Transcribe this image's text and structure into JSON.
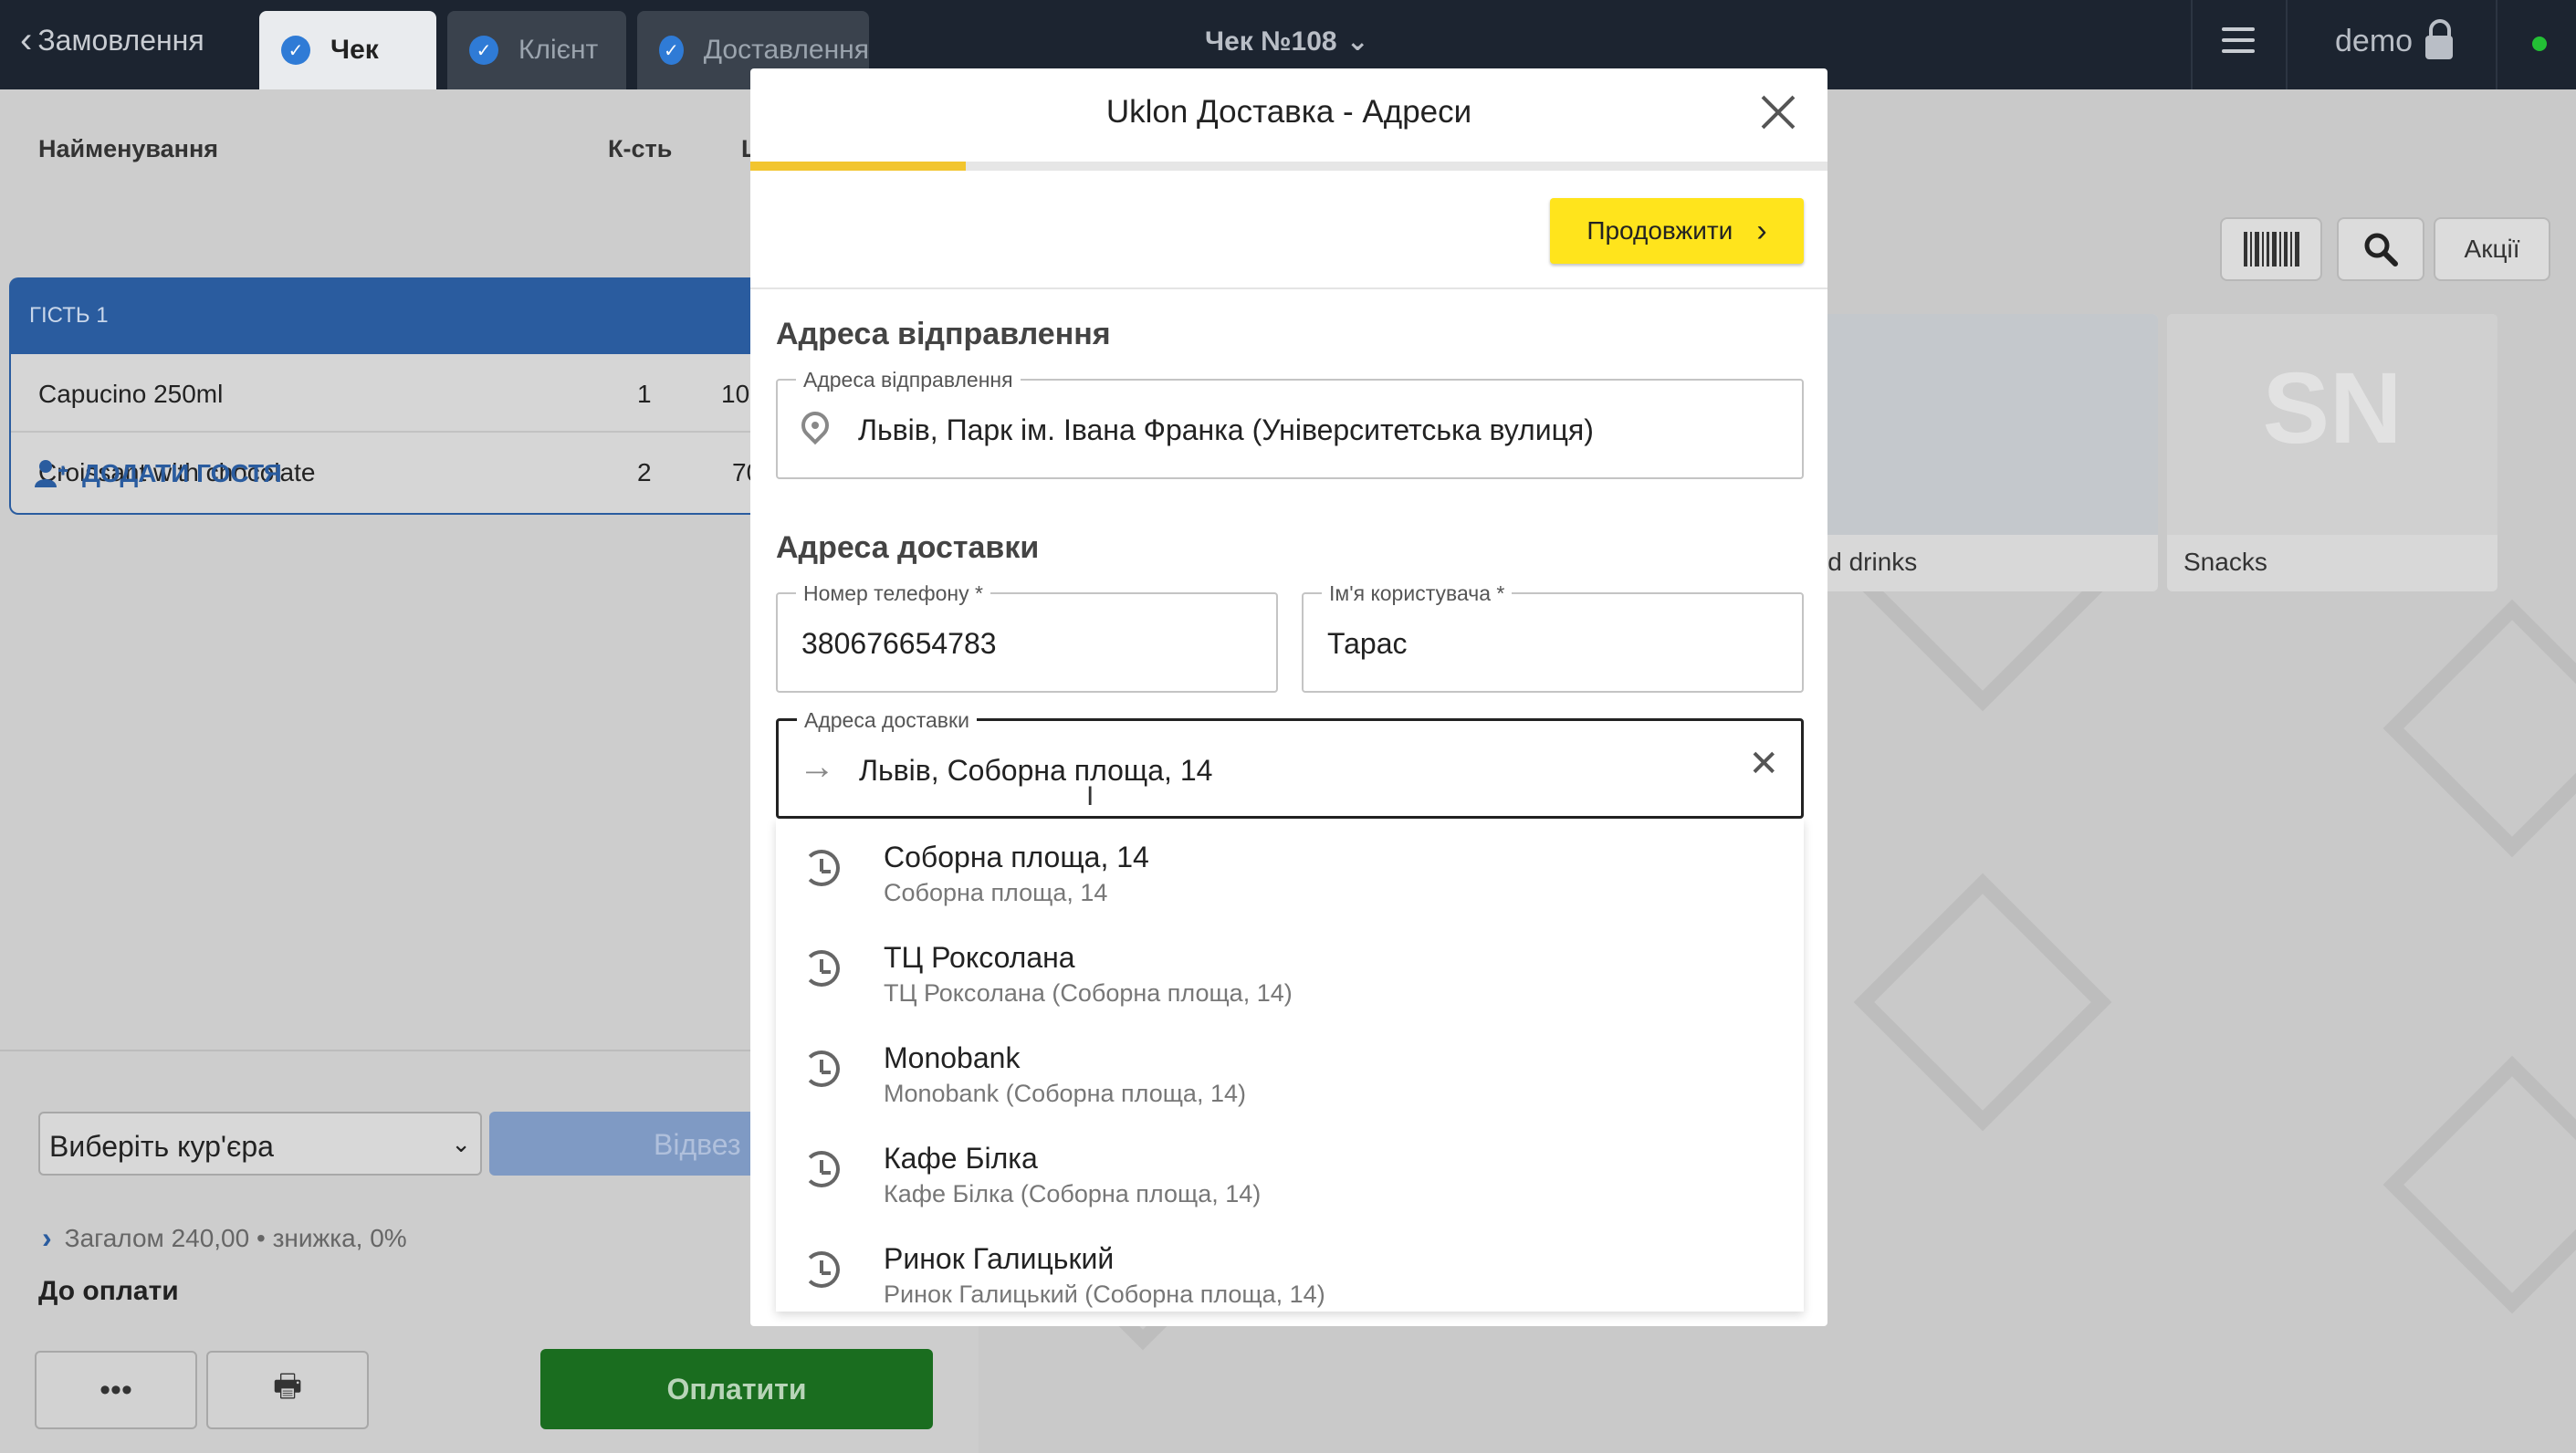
{
  "topbar": {
    "back_label": "Замовлення",
    "tabs": [
      {
        "label": "Чек",
        "active": true
      },
      {
        "label": "Клієнт",
        "active": false
      },
      {
        "label": "Доставлення",
        "active": false
      }
    ],
    "check_title": "Чек №108",
    "user": "demo",
    "status_color": "#23c035"
  },
  "order": {
    "headers": {
      "name": "Найменування",
      "qty": "К-сть",
      "price": "Ц"
    },
    "guest": "ГІСТЬ 1",
    "items": [
      {
        "name": "Capucino 250ml",
        "qty": "1",
        "price": "10"
      },
      {
        "name": "Croissant with chocolate",
        "qty": "2",
        "price": "70"
      }
    ],
    "add_guest": "ДОДАТИ ГОСТЯ"
  },
  "bottom": {
    "courier_placeholder": "Виберіть кур'єра",
    "send_label": "Відвез",
    "total_line": "Загалом 240,00 • знижка, 0%",
    "to_pay": "До оплати",
    "more_label": "•••",
    "print_label": "🖶",
    "pay_label": "Оплатити"
  },
  "right": {
    "promo_label": "Акції",
    "categories": [
      {
        "label": "ld drinks"
      },
      {
        "label": "Snacks",
        "initials": "SN"
      }
    ]
  },
  "modal": {
    "title": "Uklon Доставка - Адреси",
    "progress": 0.2,
    "continue_label": "Продовжити",
    "pickup_section": "Адреса відправлення",
    "pickup_field_label": "Адреса відправлення",
    "pickup_value": "Львів, Парк ім. Івана Франка (Університетська вулиця)",
    "delivery_section": "Адреса доставки",
    "phone_label": "Номер телефону *",
    "phone_value": "380676654783",
    "username_label": "Ім'я користувача *",
    "username_value": "Тарас",
    "delivery_field_label": "Адреса доставки",
    "delivery_value": "Львів, Соборна площа, 14",
    "suggestions": [
      {
        "title": "Соборна площа, 14",
        "subtitle": "Соборна площа, 14"
      },
      {
        "title": "ТЦ Роксолана",
        "subtitle": "ТЦ Роксолана (Соборна площа, 14)"
      },
      {
        "title": "Monobank",
        "subtitle": "Monobank (Соборна площа, 14)"
      },
      {
        "title": "Кафе Білка",
        "subtitle": "Кафе Білка (Соборна площа, 14)"
      },
      {
        "title": "Ринок Галицький",
        "subtitle": "Ринок Галицький (Соборна площа, 14)"
      }
    ]
  }
}
